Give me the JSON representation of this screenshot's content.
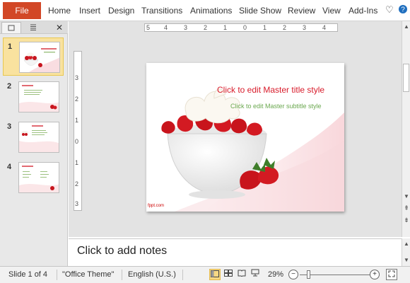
{
  "ribbon": {
    "file_label": "File",
    "tabs": [
      "Home",
      "Insert",
      "Design",
      "Transitions",
      "Animations",
      "Slide Show",
      "Review",
      "View",
      "Add-Ins"
    ],
    "icons": [
      "heart-icon",
      "help-icon"
    ]
  },
  "pane": {
    "tabs": [
      "slides-icon",
      "outline-icon"
    ],
    "close_icon": "close-icon",
    "slides": [
      {
        "number": "1",
        "selected": true
      },
      {
        "number": "2",
        "selected": false
      },
      {
        "number": "3",
        "selected": false
      },
      {
        "number": "4",
        "selected": false
      }
    ]
  },
  "ruler": {
    "horizontal_ticks": [
      "5",
      "4",
      "3",
      "2",
      "1",
      "0",
      "1",
      "2",
      "3",
      "4"
    ],
    "vertical_ticks": [
      "3",
      "2",
      "1",
      "0",
      "1",
      "2",
      "3"
    ]
  },
  "slide": {
    "title": "Click to edit Master title style",
    "subtitle": "Click to edit Master subtitle style",
    "footer": "fppt.com"
  },
  "notes": {
    "placeholder": "Click to add notes"
  },
  "status": {
    "slide_counter": "Slide 1 of 4",
    "theme": "\"Office Theme\"",
    "language": "English (U.S.)",
    "zoom": "29%",
    "zoom_level": 0.29
  },
  "colors": {
    "file_tab": "#d24726",
    "title_text": "#d81b2a",
    "subtitle_text": "#6aa84f",
    "selected_thumb": "#f9e29f"
  }
}
